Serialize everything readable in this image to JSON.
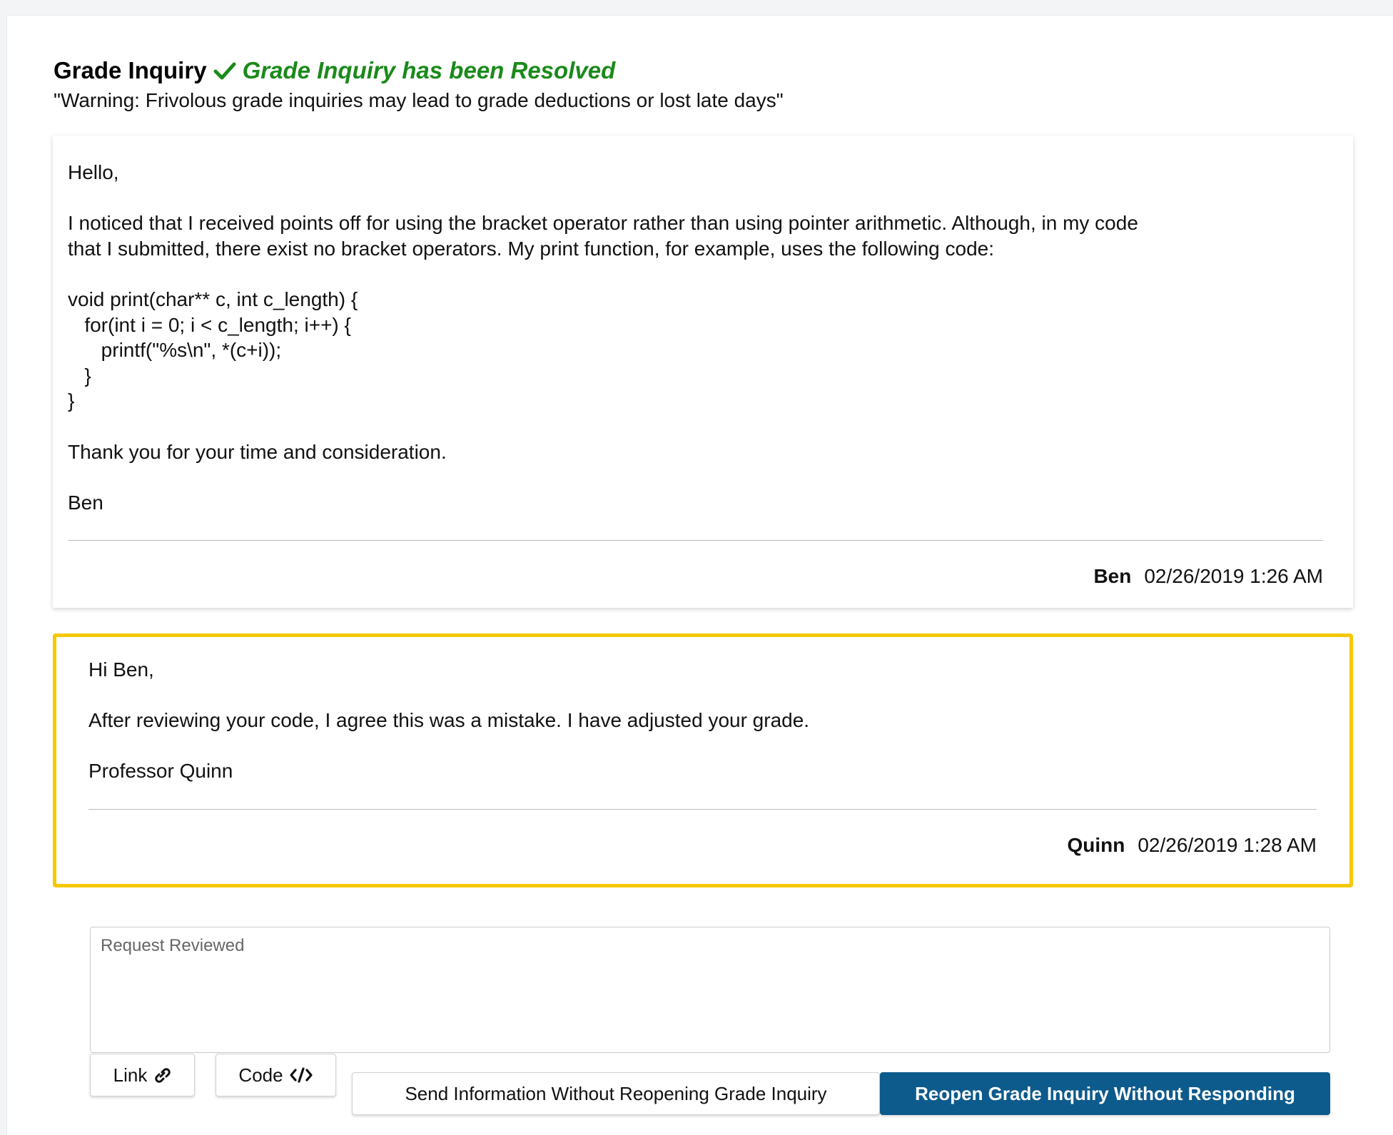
{
  "header": {
    "title": "Grade Inquiry",
    "status": "Grade Inquiry has been Resolved",
    "warning": "\"Warning: Frivolous grade inquiries may lead to grade deductions or lost late days\""
  },
  "posts": [
    {
      "lines": [
        "Hello,",
        "",
        "I noticed that I received points off for using the bracket operator rather than using pointer arithmetic. Although, in my code",
        "that I submitted, there exist no bracket operators. My print function, for example, uses the following code:",
        "",
        "void print(char** c, int c_length) {",
        "   for(int i = 0; i < c_length; i++) {",
        "      printf(\"%s\\n\", *(c+i));",
        "   }",
        "}",
        "",
        "Thank you for your time and consideration.",
        "",
        "Ben"
      ],
      "author": "Ben",
      "timestamp": "02/26/2019 1:26 AM"
    },
    {
      "lines": [
        "Hi Ben,",
        "",
        "After reviewing your code, I agree this was a mistake. I have adjusted your grade.",
        "",
        "Professor Quinn"
      ],
      "author": "Quinn",
      "timestamp": "02/26/2019 1:28 AM"
    }
  ],
  "reply": {
    "placeholder": "Request Reviewed",
    "value": ""
  },
  "buttons": {
    "link": "Link",
    "code": "Code",
    "send": "Send Information Without Reopening Grade Inquiry",
    "reopen": "Reopen Grade Inquiry Without Responding"
  },
  "colors": {
    "resolved": "#1a8a1a",
    "staff_border": "#f5c800",
    "primary_button": "#0d5a8c"
  },
  "icons": {
    "status": "checkmark-icon",
    "link": "link-icon",
    "code": "code-icon"
  }
}
